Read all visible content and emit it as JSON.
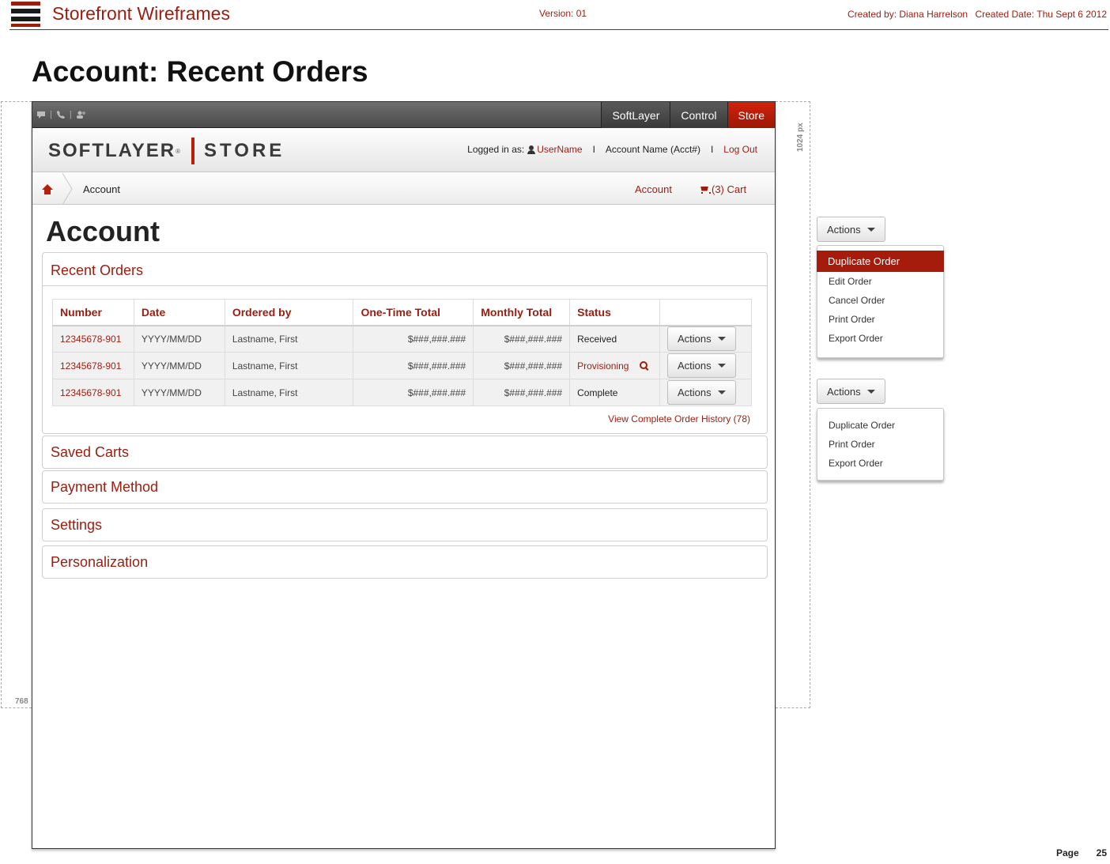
{
  "wireframe": {
    "title": "Storefront Wireframes",
    "version": "Version: 01",
    "created_by": "Created by: Diana Harrelson",
    "created_date": "Created Date: Thu Sept 6 2012",
    "page_title": "Account: Recent Orders",
    "guide_width": "1024 px",
    "guide_height": "768",
    "page_label": "Page",
    "page_number": "25"
  },
  "topbar": {
    "tabs": [
      {
        "label": "SoftLayer"
      },
      {
        "label": "Control"
      },
      {
        "label": "Store"
      }
    ]
  },
  "brand": {
    "softlayer": "SOFTLAYER",
    "reg": "®",
    "store": "STORE"
  },
  "account_line": {
    "logged_in_label": "Logged in as:",
    "username": "UserName",
    "separator": "I",
    "account_name": "Account Name (Acct#)",
    "logout": "Log Out"
  },
  "breadcrumb": {
    "current": "Account",
    "account_link": "Account",
    "cart_link": "(3) Cart"
  },
  "main": {
    "heading": "Account",
    "recent_orders": {
      "title": "Recent Orders",
      "columns": [
        "Number",
        "Date",
        "Ordered by",
        "One-Time Total",
        "Monthly Total",
        "Status"
      ],
      "rows": [
        {
          "number": "12345678-901",
          "date": "YYYY/MM/DD",
          "ordered_by": "Lastname, First",
          "one_time": "$###,###.###",
          "monthly": "$###,###.###",
          "status": "Received",
          "action": "Actions"
        },
        {
          "number": "12345678-901",
          "date": "YYYY/MM/DD",
          "ordered_by": "Lastname, First",
          "one_time": "$###,###.###",
          "monthly": "$###,###.###",
          "status": "Provisioning",
          "action": "Actions"
        },
        {
          "number": "12345678-901",
          "date": "YYYY/MM/DD",
          "ordered_by": "Lastname, First",
          "one_time": "$###,###.###",
          "monthly": "$###,###.###",
          "status": "Complete",
          "action": "Actions"
        }
      ],
      "history_link": "View Complete Order History (78)"
    },
    "sections": [
      "Saved Carts",
      "Payment Method",
      "Settings",
      "Personalization"
    ]
  },
  "menus": {
    "first": {
      "button": "Actions",
      "items": [
        "Duplicate Order",
        "Edit Order",
        "Cancel Order",
        "Print Order",
        "Export Order"
      ],
      "highlighted": "Duplicate Order"
    },
    "second": {
      "button": "Actions",
      "items": [
        "Duplicate Order",
        "Print Order",
        "Export Order"
      ]
    }
  },
  "colors": {
    "accent": "#9b1d10",
    "store_tab": "#c41f0a",
    "menu_highlight": "#a51c0d"
  },
  "icons": {
    "topbar": [
      "chat-icon",
      "phone-icon",
      "users-icon"
    ],
    "home": "home-icon",
    "user": "user-icon",
    "cart": "cart-icon",
    "status_detail": "magnifier-icon",
    "dropdown": "caret-down-icon"
  }
}
